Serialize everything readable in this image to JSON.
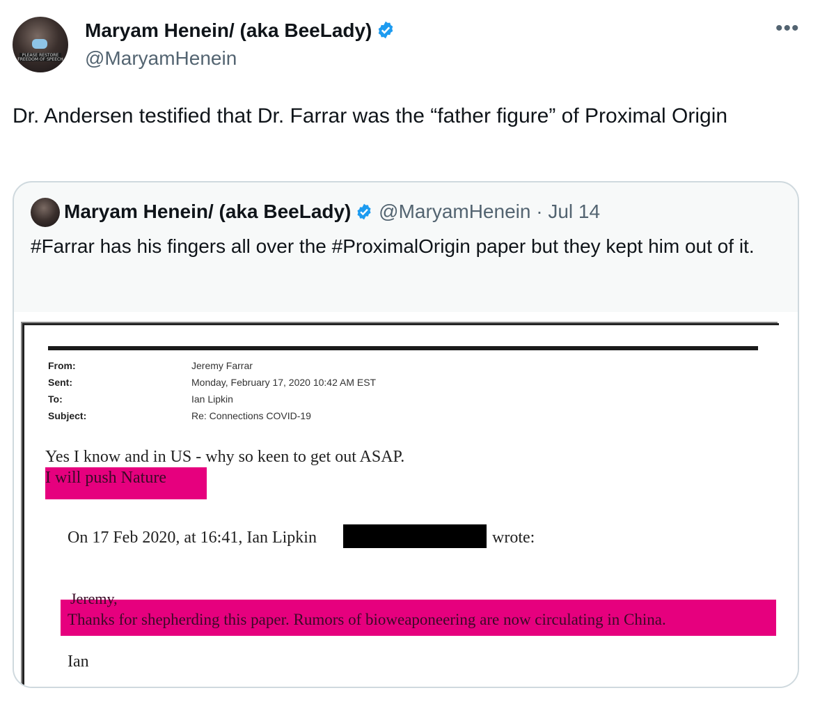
{
  "tweet": {
    "author_name": "Maryam Henein/ (aka BeeLady)",
    "author_handle": "@MaryamHenein",
    "avatar_caption_1": "PLEASE RESTORE",
    "avatar_caption_2": "FREEDOM OF SPEECH",
    "more_icon": "•••",
    "text": "Dr. Andersen testified that Dr. Farrar was the “father figure” of Proximal Origin"
  },
  "quoted": {
    "author_name": "Maryam Henein/ (aka BeeLady)",
    "meta": "@MaryamHenein · Jul 14",
    "text": "#Farrar has his fingers all over the #ProximalOrigin paper but they kept him out of it."
  },
  "email": {
    "fields": [
      {
        "label": "From:",
        "value": "Jeremy Farrar"
      },
      {
        "label": "Sent:",
        "value": "Monday, February 17, 2020 10:42 AM EST"
      },
      {
        "label": "To:",
        "value": "Ian Lipkin"
      },
      {
        "label": "Subject:",
        "value": "Re: Connections COVID-19"
      }
    ],
    "body_line_1": "Yes I know and in US - why so keen to get out ASAP.",
    "body_line_2": "I will push Nature",
    "reply_prefix": "On 17 Feb 2020, at 16:41, Ian Lipkin",
    "reply_suffix": "wrote:",
    "greeting": "Jeremy,",
    "quoted_line": "Thanks for shepherding this paper. Rumors of bioweaponeering are now circulating in China.",
    "signoff": "Ian"
  },
  "colors": {
    "verified": "#1d9bf0",
    "highlight": "#e6007e",
    "secondary_text": "#536471"
  }
}
